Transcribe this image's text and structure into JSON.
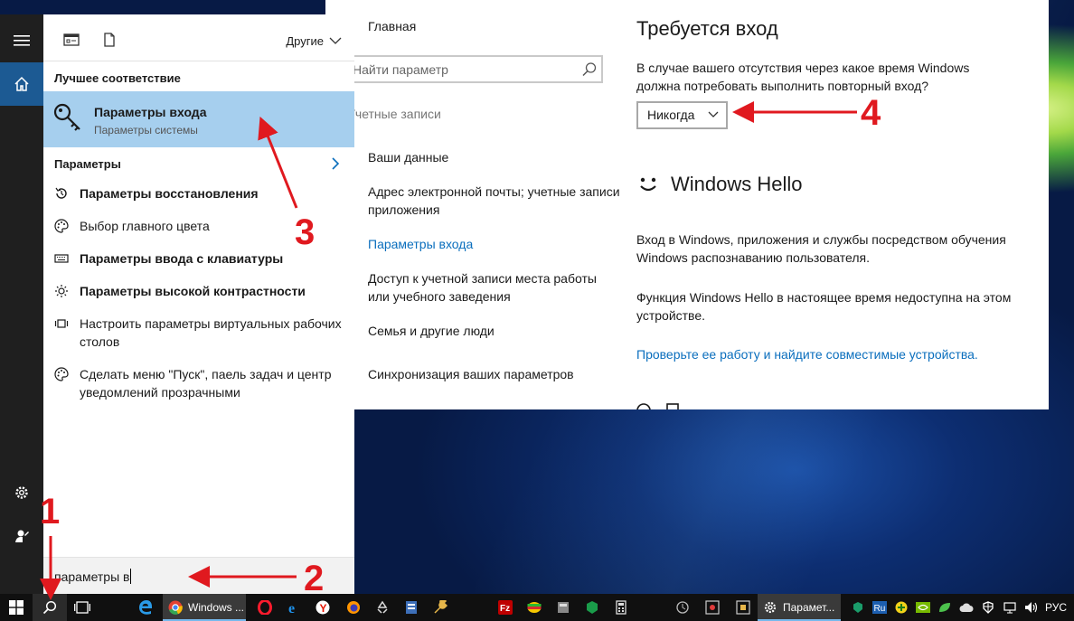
{
  "settings": {
    "nav_home": "Главная",
    "search_placeholder": "Найти параметр",
    "nav_section": "Учетные записи",
    "nav_items": [
      "Ваши данные",
      "Адрес электронной почты; учетные записи приложения",
      "Параметры входа",
      "Доступ к учетной записи места работы или учебного заведения",
      "Семья и другие люди",
      "Синхронизация ваших параметров"
    ],
    "title": "Требуется вход",
    "require_question": "В случае вашего отсутствия через какое время Windows должна потребовать выполнить повторный вход?",
    "dropdown_value": "Никогда",
    "hello_title": "Windows Hello",
    "hello_desc1": "Вход в Windows, приложения и службы посредством обучения Windows распознаванию пользователя.",
    "hello_desc2": "Функция Windows Hello в настоящее время недоступна на этом устройстве.",
    "hello_link": "Проверьте ее работу и найдите совместимые устройства."
  },
  "start": {
    "tab_other": "Другие",
    "best_match_title": "Лучшее соответствие",
    "best_match": {
      "name": "Параметры входа",
      "sub": "Параметры системы"
    },
    "params_title": "Параметры",
    "results": [
      {
        "icon": "restore-icon",
        "text": "Параметры восстановления",
        "bold": true
      },
      {
        "icon": "palette-icon",
        "text": "Выбор главного цвета",
        "bold": false
      },
      {
        "icon": "keyboard-icon",
        "text": "Параметры ввода с клавиатуры",
        "bold": true
      },
      {
        "icon": "brightness-icon",
        "text": "Параметры высокой контрастности",
        "bold": true
      },
      {
        "icon": "desktops-icon",
        "text": "Настроить параметры виртуальных рабочих столов",
        "bold": false
      },
      {
        "icon": "palette-icon",
        "text": "Сделать меню \"Пуск\", паель задач и центр уведомлений прозрачными",
        "bold": false
      }
    ],
    "search_query": "параметры в"
  },
  "taskbar": {
    "chrome_label": "Windows ...",
    "settings_label": "Парамет...",
    "language": "РУС"
  },
  "annotations": [
    "1",
    "2",
    "3",
    "4"
  ],
  "colors": {
    "accent": "#0a6ebd",
    "highlight": "#a6cfee",
    "annotation": "#e0191f",
    "rail": "#1f1f1f"
  }
}
